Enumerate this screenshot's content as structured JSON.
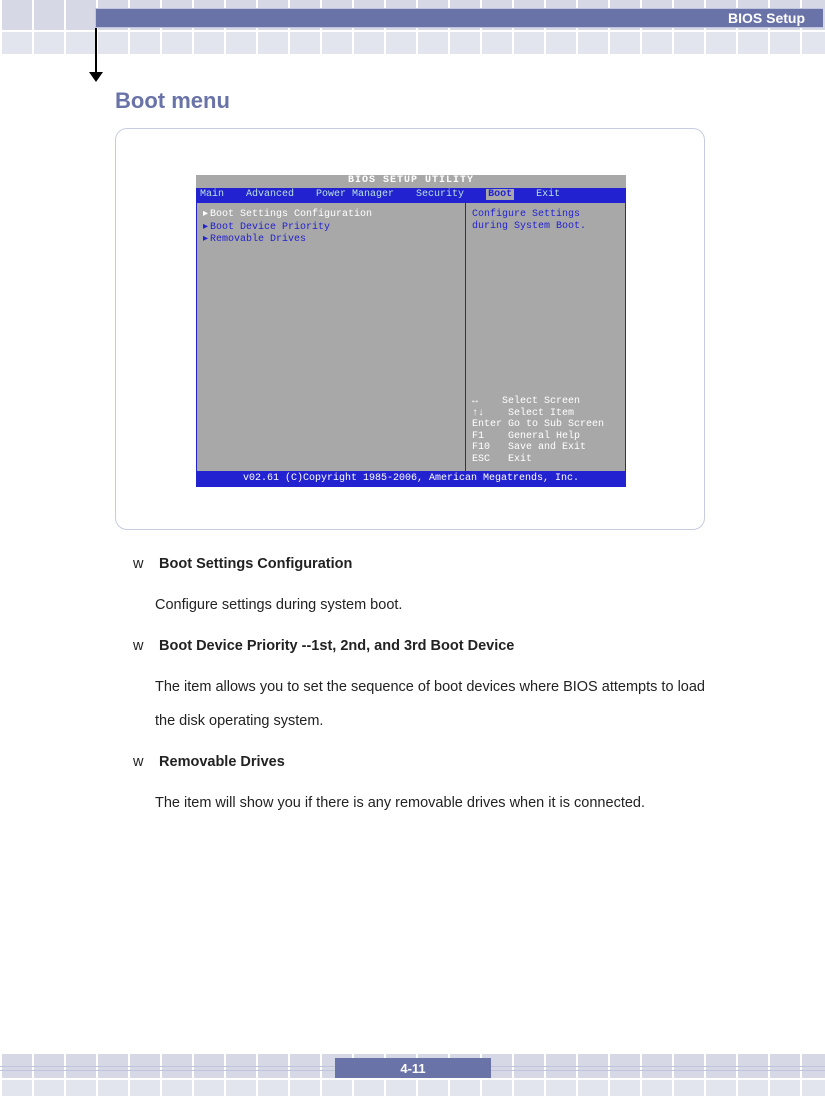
{
  "header": {
    "label": "BIOS Setup"
  },
  "page_title": "Boot menu",
  "bios": {
    "utility_title": "BIOS SETUP UTILITY",
    "tabs": [
      "Main",
      "Advanced",
      "Power Manager",
      "Security",
      "Boot",
      "Exit"
    ],
    "active_tab": "Boot",
    "items": [
      "Boot Settings Configuration",
      "Boot Device Priority",
      "Removable Drives"
    ],
    "help_line1": "Configure Settings",
    "help_line2": "during System Boot.",
    "hints": [
      {
        "key": "↔",
        "action": "Select Screen"
      },
      {
        "key": "↑↓",
        "action": "Select Item"
      },
      {
        "key": "Enter",
        "action": "Go to Sub Screen"
      },
      {
        "key": "F1",
        "action": "General Help"
      },
      {
        "key": "F10",
        "action": "Save and Exit"
      },
      {
        "key": "ESC",
        "action": "Exit"
      }
    ],
    "footer": "v02.61 (C)Copyright 1985-2006, American Megatrends, Inc."
  },
  "sections": [
    {
      "bullet": "w",
      "title": "Boot Settings Configuration",
      "body": "Configure settings during system boot."
    },
    {
      "bullet": "w",
      "title": "Boot Device Priority --1st, 2nd, and 3rd Boot Device",
      "body": "The item allows you to set the sequence of boot devices where BIOS attempts to load the disk operating system."
    },
    {
      "bullet": "w",
      "title": "Removable Drives",
      "body": "The item will show you if there is any removable drives when it is connected."
    }
  ],
  "page_number": "4-11"
}
